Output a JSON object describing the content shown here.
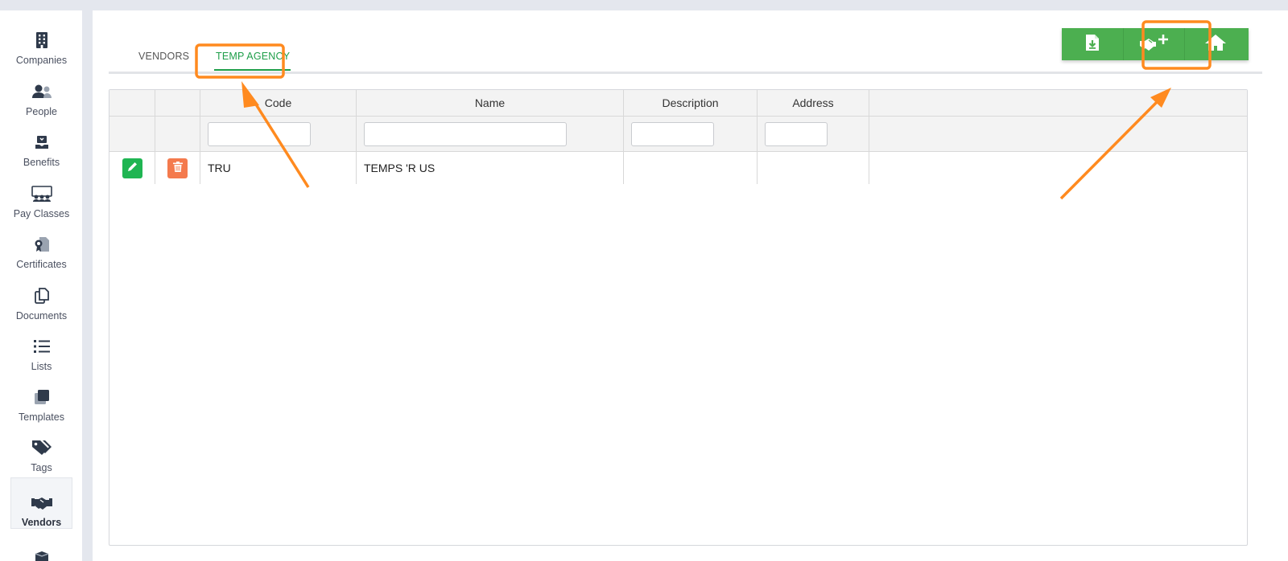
{
  "sidebar": {
    "items": [
      {
        "label": "Companies",
        "icon": "building-icon"
      },
      {
        "label": "People",
        "icon": "people-icon"
      },
      {
        "label": "Benefits",
        "icon": "benefits-icon"
      },
      {
        "label": "Pay Classes",
        "icon": "pay-classes-icon"
      },
      {
        "label": "Certificates",
        "icon": "certificate-icon"
      },
      {
        "label": "Documents",
        "icon": "documents-icon"
      },
      {
        "label": "Lists",
        "icon": "list-icon"
      },
      {
        "label": "Templates",
        "icon": "templates-icon"
      },
      {
        "label": "Tags",
        "icon": "tags-icon"
      },
      {
        "label": "Vendors",
        "icon": "handshake-icon",
        "active": true
      }
    ]
  },
  "tabs": {
    "vendors": "VENDORS",
    "temp_agency": "TEMP AGENCY",
    "active": "TEMP AGENCY"
  },
  "toolbar": {
    "buttons": [
      {
        "name": "download-file",
        "icon": "file-download-icon"
      },
      {
        "name": "add-temp-agency",
        "icon": "handshake-plus-icon"
      },
      {
        "name": "home",
        "icon": "home-icon"
      }
    ]
  },
  "table": {
    "columns": [
      "",
      "",
      "Code",
      "Name",
      "Description",
      "Address"
    ],
    "rows": [
      {
        "code": "TRU",
        "name": "TEMPS 'R US",
        "description": "",
        "address": ""
      }
    ]
  },
  "colors": {
    "accent_green": "#4caf50",
    "tab_active": "#1e9e49",
    "edit_button": "#1fb552",
    "delete_button": "#f47a4d",
    "annotation": "#ff8a1f"
  }
}
